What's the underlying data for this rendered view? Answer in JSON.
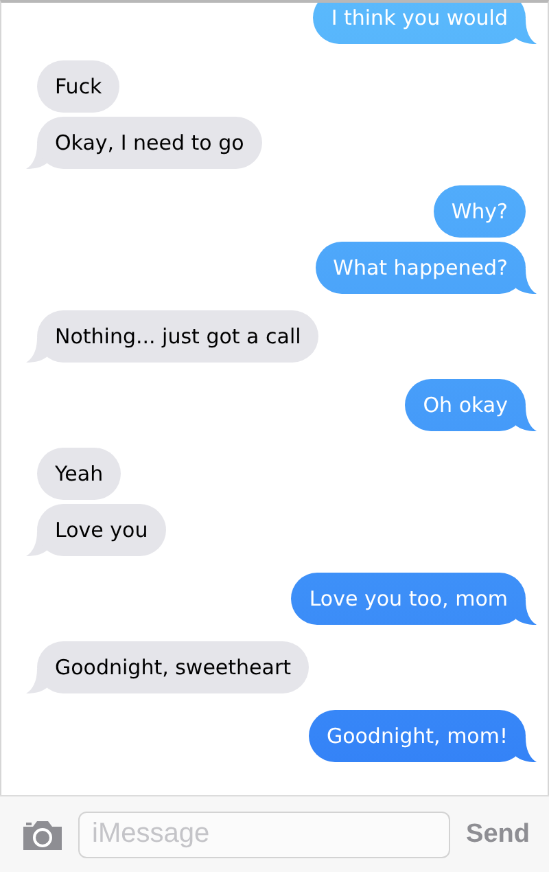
{
  "messages": [
    {
      "text": "I think you would",
      "kind": "sent",
      "tail": true
    },
    {
      "text": "Fuck",
      "kind": "received",
      "tail": false
    },
    {
      "text": "Okay, I need to go",
      "kind": "received",
      "tail": true
    },
    {
      "text": "Why?",
      "kind": "sent",
      "tail": false
    },
    {
      "text": "What happened?",
      "kind": "sent",
      "tail": true
    },
    {
      "text": "Nothing... just got a call",
      "kind": "received",
      "tail": true
    },
    {
      "text": "Oh okay",
      "kind": "sent",
      "tail": true
    },
    {
      "text": "Yeah",
      "kind": "received",
      "tail": false
    },
    {
      "text": "Love you",
      "kind": "received",
      "tail": true
    },
    {
      "text": "Love you too, mom",
      "kind": "sent",
      "tail": true
    },
    {
      "text": "Goodnight, sweetheart",
      "kind": "received",
      "tail": true
    },
    {
      "text": "Goodnight, mom!",
      "kind": "sent",
      "tail": true
    }
  ],
  "composer": {
    "placeholder": "iMessage",
    "send": "Send"
  }
}
